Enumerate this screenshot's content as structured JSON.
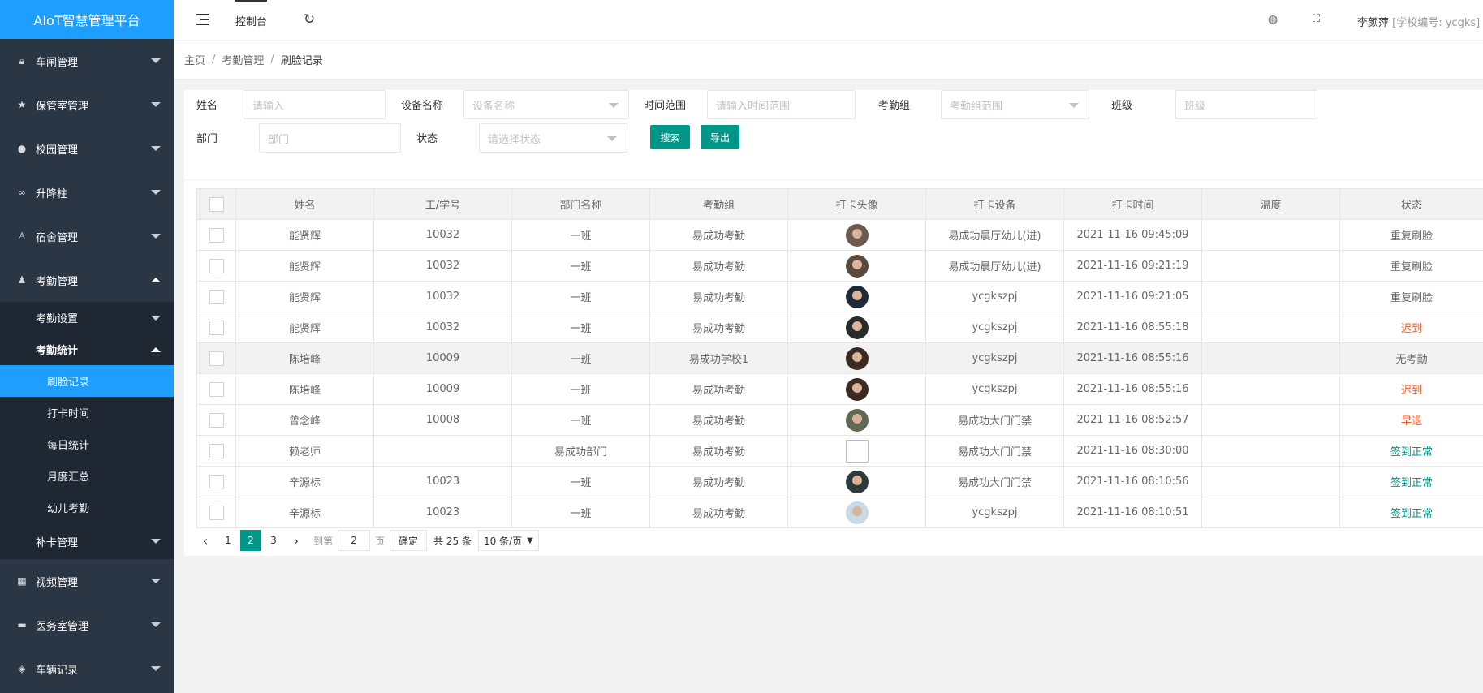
{
  "app": {
    "title": "AIoT智慧管理平台"
  },
  "sidebar": {
    "top_items": [
      {
        "label": "车闸管理",
        "icon": "lock-icon"
      },
      {
        "label": "保管室管理",
        "icon": "star-icon"
      },
      {
        "label": "校园管理",
        "icon": "person-icon"
      },
      {
        "label": "升降柱",
        "icon": "link-icon"
      },
      {
        "label": "宿舍管理",
        "icon": "group-icon"
      },
      {
        "label": "考勤管理",
        "icon": "user-icon"
      }
    ],
    "attendance_sub": [
      {
        "label": "考勤设置"
      },
      {
        "label": "考勤统计"
      }
    ],
    "stats_leaves": [
      {
        "label": "刷脸记录"
      },
      {
        "label": "打卡时间"
      },
      {
        "label": "每日统计"
      },
      {
        "label": "月度汇总"
      },
      {
        "label": "幼儿考勤"
      }
    ],
    "makeup": {
      "label": "补卡管理"
    },
    "bottom_items": [
      {
        "label": "视频管理",
        "icon": "video-icon"
      },
      {
        "label": "医务室管理",
        "icon": "medical-icon"
      },
      {
        "label": "车辆记录",
        "icon": "box-icon"
      }
    ]
  },
  "header": {
    "tab": "控制台",
    "user": "李颜萍",
    "school": "[学校编号: ycgks]"
  },
  "breadcrumb": [
    "主页",
    "考勤管理",
    "刷脸记录"
  ],
  "filters": {
    "name_label": "姓名",
    "name_placeholder": "请输入",
    "device_label": "设备名称",
    "device_placeholder": "设备名称",
    "time_label": "时间范围",
    "time_placeholder": "请输入时间范围",
    "group_label": "考勤组",
    "group_placeholder": "考勤组范围",
    "class_label": "班级",
    "class_placeholder": "班级",
    "dept_label": "部门",
    "dept_placeholder": "部门",
    "status_label": "状态",
    "status_placeholder": "请选择状态",
    "search_btn": "搜索",
    "export_btn": "导出"
  },
  "table": {
    "columns": [
      "姓名",
      "工/学号",
      "部门名称",
      "考勤组",
      "打卡头像",
      "打卡设备",
      "打卡时间",
      "温度",
      "状态"
    ],
    "rows": [
      {
        "name": "能贤辉",
        "id": "10032",
        "dept": "一班",
        "group": "易成功考勤",
        "device": "易成功晨厅幼儿(进)",
        "time": "2021-11-16 09:45:09",
        "temp": "",
        "status": "重复刷脸",
        "status_type": "normal",
        "avatar": "#6b5a4e"
      },
      {
        "name": "能贤辉",
        "id": "10032",
        "dept": "一班",
        "group": "易成功考勤",
        "device": "易成功晨厅幼儿(进)",
        "time": "2021-11-16 09:21:19",
        "temp": "",
        "status": "重复刷脸",
        "status_type": "normal",
        "avatar": "#5a4a3e"
      },
      {
        "name": "能贤辉",
        "id": "10032",
        "dept": "一班",
        "group": "易成功考勤",
        "device": "ycgkszpj",
        "time": "2021-11-16 09:21:05",
        "temp": "",
        "status": "重复刷脸",
        "status_type": "normal",
        "avatar": "#1e2a36"
      },
      {
        "name": "能贤辉",
        "id": "10032",
        "dept": "一班",
        "group": "易成功考勤",
        "device": "ycgkszpj",
        "time": "2021-11-16 08:55:18",
        "temp": "",
        "status": "迟到",
        "status_type": "warn",
        "avatar": "#2a2a2a"
      },
      {
        "name": "陈培峰",
        "id": "10009",
        "dept": "一班",
        "group": "易成功学校1",
        "device": "ycgkszpj",
        "time": "2021-11-16 08:55:16",
        "temp": "",
        "status": "无考勤",
        "status_type": "normal",
        "avatar": "#3b2a22"
      },
      {
        "name": "陈培峰",
        "id": "10009",
        "dept": "一班",
        "group": "易成功考勤",
        "device": "ycgkszpj",
        "time": "2021-11-16 08:55:16",
        "temp": "",
        "status": "迟到",
        "status_type": "warn",
        "avatar": "#3b2a22"
      },
      {
        "name": "曾念峰",
        "id": "10008",
        "dept": "一班",
        "group": "易成功考勤",
        "device": "易成功大门门禁",
        "time": "2021-11-16 08:52:57",
        "temp": "",
        "status": "早退",
        "status_type": "warn",
        "avatar": "#5e6a52"
      },
      {
        "name": "赖老师",
        "id": "",
        "dept": "易成功部门",
        "group": "易成功考勤",
        "device": "易成功大门门禁",
        "time": "2021-11-16 08:30:00",
        "temp": "",
        "status": "签到正常",
        "status_type": "ok",
        "avatar": "broken"
      },
      {
        "name": "辛源标",
        "id": "10023",
        "dept": "一班",
        "group": "易成功考勤",
        "device": "易成功大门门禁",
        "time": "2021-11-16 08:10:56",
        "temp": "",
        "status": "签到正常",
        "status_type": "ok",
        "avatar": "#2f3a3a"
      },
      {
        "name": "辛源标",
        "id": "10023",
        "dept": "一班",
        "group": "易成功考勤",
        "device": "ycgkszpj",
        "time": "2021-11-16 08:10:51",
        "temp": "",
        "status": "签到正常",
        "status_type": "ok",
        "avatar": "#c9d9e6"
      }
    ],
    "highlighted_row": 4
  },
  "pager": {
    "pages": [
      "1",
      "2",
      "3"
    ],
    "current": "2",
    "goto_label": "到第",
    "goto_value": "2",
    "page_label": "页",
    "confirm": "确定",
    "total": "共 25 条",
    "page_size": "10 条/页"
  },
  "colors": {
    "sidebar": "#2b3645",
    "accent": "#1e9fff",
    "primary": "#009688",
    "warn": "#ff5722"
  }
}
